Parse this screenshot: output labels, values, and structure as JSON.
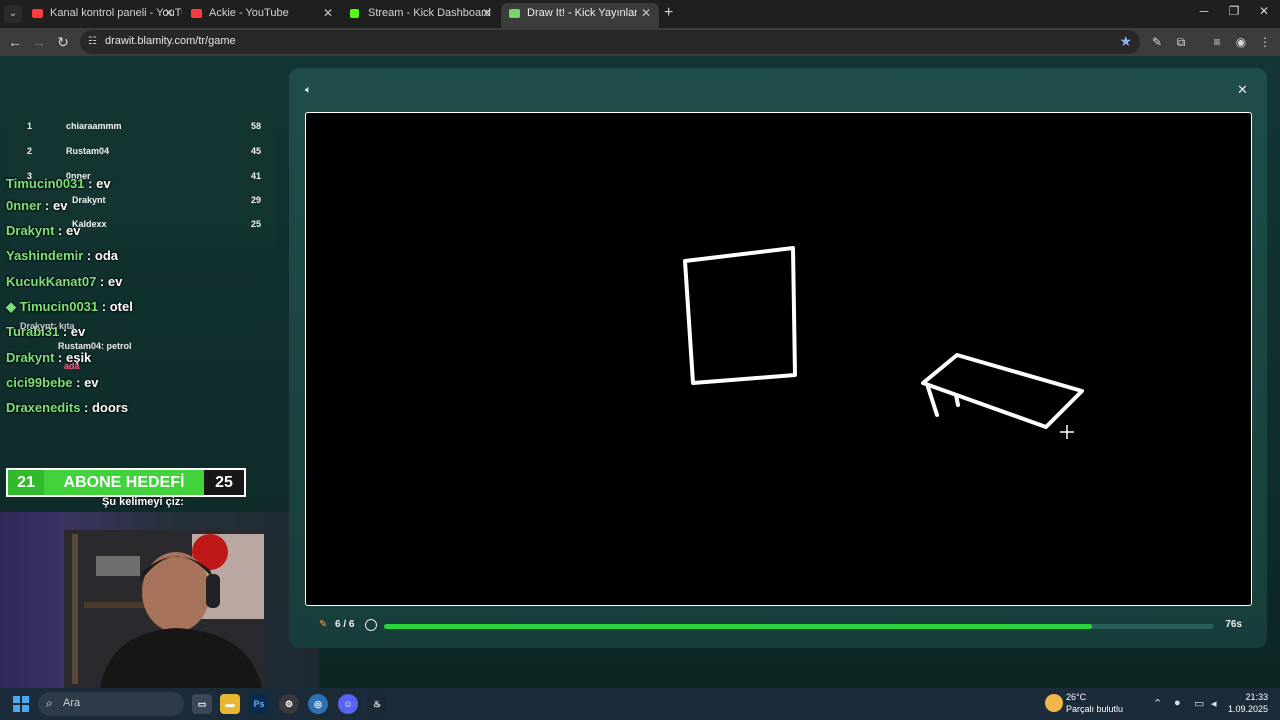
{
  "browser": {
    "tabs": [
      {
        "title": "Kanal kontrol paneli - YouTube",
        "favicon_color": "#ff3b3b",
        "active": false
      },
      {
        "title": "Ackie - YouTube",
        "favicon_color": "#ff3b3b",
        "active": false
      },
      {
        "title": "Stream - Kick Dashboard",
        "favicon_color": "#53fc18",
        "active": false
      },
      {
        "title": "Draw It! - Kick Yayınları İçin Çizi",
        "favicon_color": "#7ad36a",
        "active": true
      }
    ],
    "url": "drawit.blamity.com/tr/game",
    "icons": {
      "back": "back-arrow-icon",
      "forward": "forward-arrow-icon",
      "reload": "reload-icon",
      "bookmark": "star-icon",
      "extensions": "puzzle-icon",
      "profile": "profile-icon"
    }
  },
  "leaderboard": [
    {
      "rank": "1",
      "name": "chiaraammm",
      "score": "58"
    },
    {
      "rank": "2",
      "name": "Rustam04",
      "score": "45"
    },
    {
      "rank": "3",
      "name": "0nner",
      "score": "41"
    },
    {
      "rank": "",
      "name": "Drakynt",
      "score": "29"
    },
    {
      "rank": "",
      "name": "Kaldexx",
      "score": "25"
    }
  ],
  "chat": [
    {
      "user": "Timucin0031",
      "sep": " : ",
      "msg": "ev"
    },
    {
      "user": "0nner",
      "sep": " : ",
      "msg": "ev"
    },
    {
      "user": "Drakynt",
      "sep": " : ",
      "msg": "ev"
    },
    {
      "user": "Yashindemir",
      "sep": " : ",
      "msg": "oda"
    },
    {
      "user": "KucukKanat07",
      "sep": " : ",
      "msg": "ev"
    },
    {
      "user": "Timucin0031",
      "sep": " : ",
      "msg": "otel"
    },
    {
      "user": "Turabi31",
      "sep": " : ",
      "msg": "ev"
    },
    {
      "user": "Drakynt",
      "sep": " : ",
      "msg": "eşik"
    },
    {
      "user": "cici99bebe",
      "sep": " : ",
      "msg": "ev"
    },
    {
      "user": "Draxenedits",
      "sep": " : ",
      "msg": "doors"
    }
  ],
  "chat_ghosts": [
    {
      "text": "Drakynt: kıta"
    },
    {
      "text": "Rustam04: petrol"
    },
    {
      "text": "ada"
    }
  ],
  "sub_goal": {
    "current": "21",
    "label": "ABONE HEDEFİ",
    "target": "25"
  },
  "draw_prompt": "Şu kelimeyi çiz:",
  "game": {
    "round": "6 / 6",
    "timer": "76s",
    "timer_progress": 0.853,
    "colors": {
      "canvas": "#000000",
      "stroke": "#ffffff",
      "timer": "#28d33b"
    }
  },
  "taskbar": {
    "search_placeholder": "Ara",
    "weather_temp": "26°C",
    "weather_desc": "Parçalı bulutlu",
    "time": "21:33",
    "date": "1.09.2025"
  }
}
